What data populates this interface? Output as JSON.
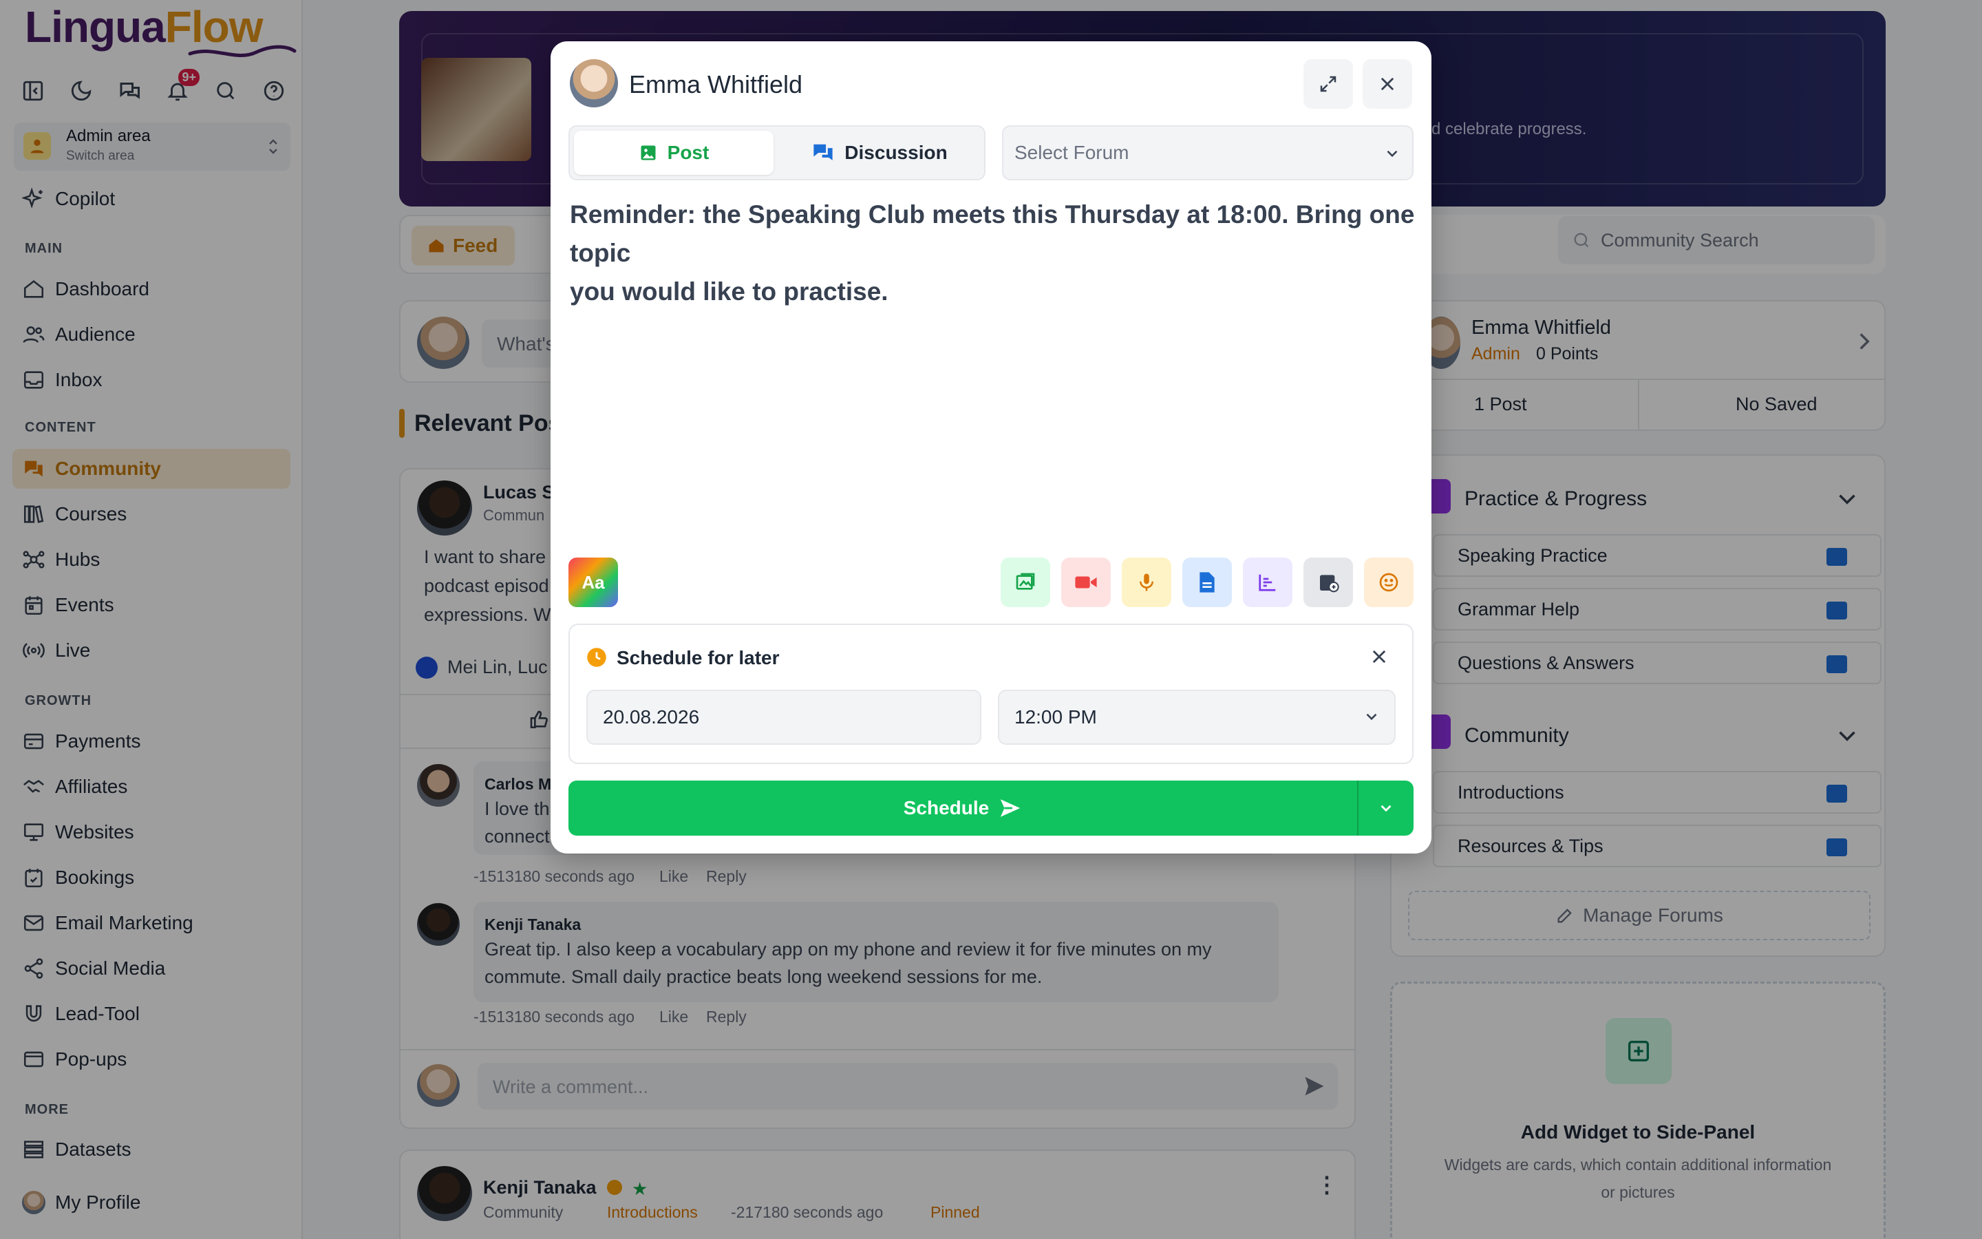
{
  "sidebar": {
    "logo_part1": "Lingua",
    "logo_part2": "Flow",
    "notification_count": "9+",
    "area_title": "Admin area",
    "area_sub": "Switch area",
    "copilot": "Copilot",
    "sections": {
      "main": "MAIN",
      "content": "CONTENT",
      "growth": "GROWTH",
      "more": "MORE"
    },
    "items": {
      "dashboard": "Dashboard",
      "audience": "Audience",
      "inbox": "Inbox",
      "community": "Community",
      "courses": "Courses",
      "hubs": "Hubs",
      "events": "Events",
      "live": "Live",
      "payments": "Payments",
      "affiliates": "Affiliates",
      "websites": "Websites",
      "bookings": "Bookings",
      "email_marketing": "Email Marketing",
      "social_media": "Social Media",
      "lead_tool": "Lead-Tool",
      "popups": "Pop-ups",
      "datasets": "Datasets",
      "my_profile": "My Profile"
    }
  },
  "background": {
    "banner_text": "d celebrate progress.",
    "feed_tab": "Feed",
    "search_placeholder": "Community Search",
    "composer_placeholder": "What's",
    "relevant_heading": "Relevant Pos",
    "post1": {
      "author": "Lucas S",
      "meta": "Commun",
      "body_l1": "I want to share",
      "body_l2": "podcast episod",
      "body_l3": "expressions. W",
      "reactions": "Mei Lin, Luc"
    },
    "comment1": {
      "author": "Carlos M",
      "l1": "I love th",
      "l2": "connect",
      "time": "-1513180 seconds ago",
      "like": "Like",
      "reply": "Reply"
    },
    "comment2": {
      "author": "Kenji Tanaka",
      "l1": "Great tip. I also keep a vocabulary app on my phone and review it for five minutes on my",
      "l2": "commute. Small daily practice beats long weekend sessions for me.",
      "time": "-1513180 seconds ago",
      "like": "Like",
      "reply": "Reply"
    },
    "comment_placeholder": "Write a comment...",
    "post2": {
      "author": "Kenji Tanaka",
      "crumb": "Community",
      "forum": "Introductions",
      "time": "-217180 seconds ago",
      "pinned": "Pinned"
    },
    "profile": {
      "name": "Emma Whitfield",
      "role": "Admin",
      "points": "0 Points",
      "posts": "1 Post",
      "saved": "No Saved"
    },
    "groups": [
      {
        "title": "Practice & Progress",
        "forums": [
          "Speaking Practice",
          "Grammar Help",
          "Questions & Answers"
        ]
      },
      {
        "title": "Community",
        "forums": [
          "Introductions",
          "Resources & Tips"
        ]
      }
    ],
    "manage_forums": "Manage Forums",
    "widget_title": "Add Widget to Side-Panel",
    "widget_desc_l1": "Widgets are cards, which contain additional information",
    "widget_desc_l2": "or pictures"
  },
  "modal": {
    "author": "Emma Whitfield",
    "tab_post": "Post",
    "tab_discussion": "Discussion",
    "forum_placeholder": "Select Forum",
    "content_l1": "Reminder: the Speaking Club meets this Thursday at 18:00. Bring one topic",
    "content_l2": "you would like to practise.",
    "format_icon": "Aa",
    "schedule_title": "Schedule for later",
    "date": "20.08.2026",
    "time": "12:00 PM",
    "schedule_button": "Schedule"
  },
  "colors": {
    "accent": "#e0941a",
    "brand": "#4a1d67",
    "green": "#10c35e",
    "forum_blue": "#1d6fd8"
  }
}
